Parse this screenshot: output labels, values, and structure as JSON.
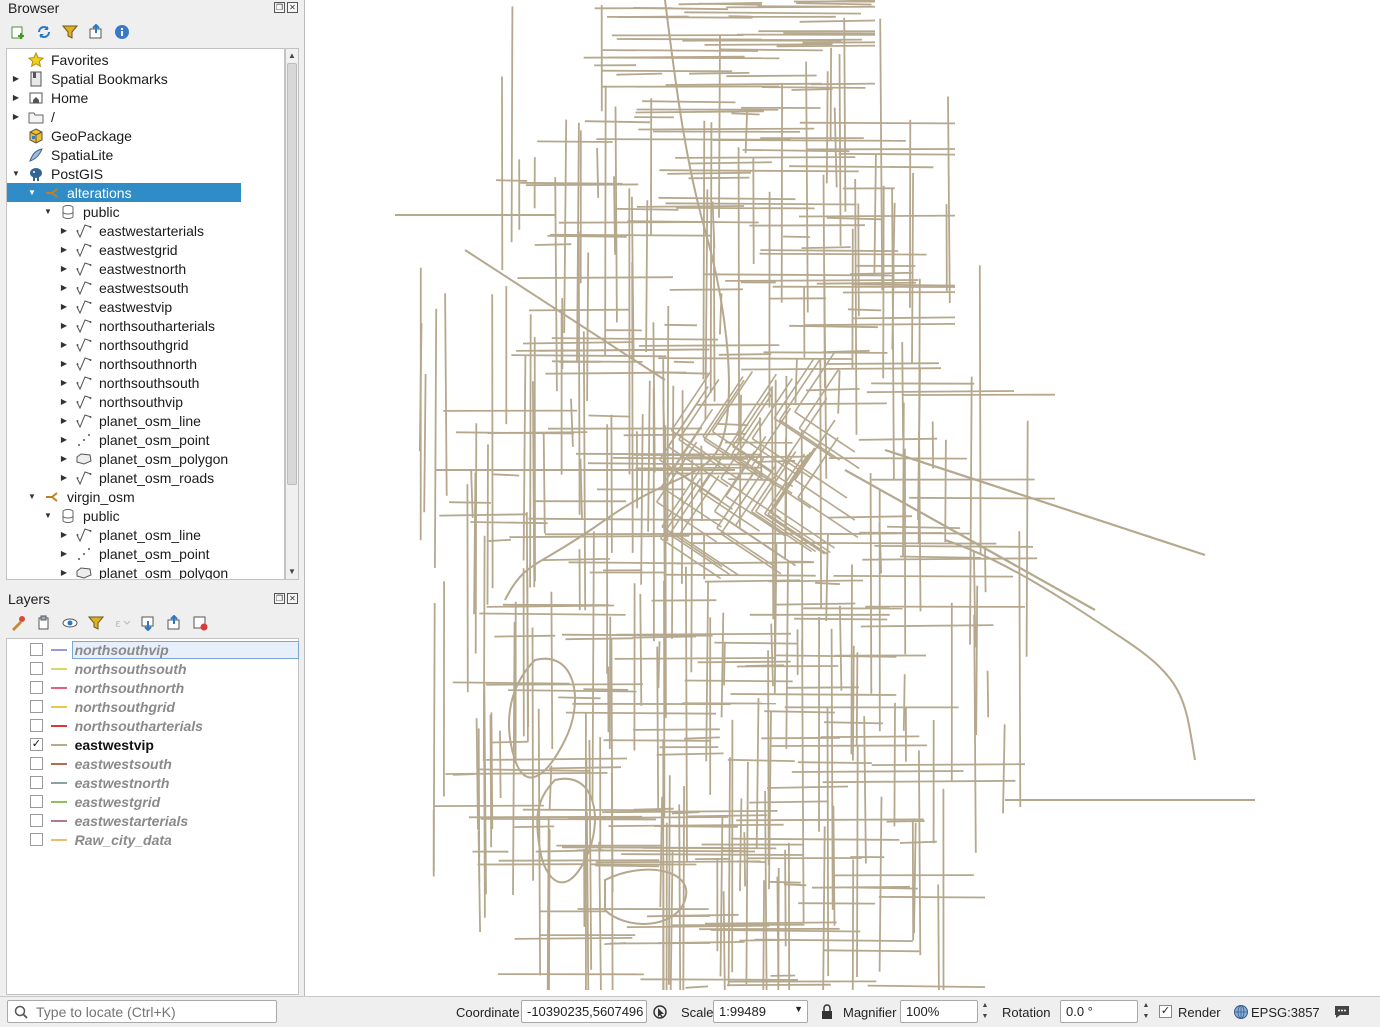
{
  "browser": {
    "title": "Browser",
    "toolbar": [
      "add-layer-icon",
      "refresh-icon",
      "filter-icon",
      "collapse-all-icon",
      "info-icon"
    ],
    "items": [
      {
        "label": "Favorites",
        "icon": "star-icon",
        "depth": 0,
        "arrow": ""
      },
      {
        "label": "Spatial Bookmarks",
        "icon": "bookmark-icon",
        "depth": 0,
        "arrow": "▶"
      },
      {
        "label": "Home",
        "icon": "home-icon",
        "depth": 0,
        "arrow": "▶"
      },
      {
        "label": "/",
        "icon": "folder-icon",
        "depth": 0,
        "arrow": "▶"
      },
      {
        "label": "GeoPackage",
        "icon": "geopackage-icon",
        "depth": 0,
        "arrow": ""
      },
      {
        "label": "SpatiaLite",
        "icon": "spatialite-icon",
        "depth": 0,
        "arrow": ""
      },
      {
        "label": "PostGIS",
        "icon": "postgis-elephant-icon",
        "depth": 0,
        "arrow": "▼"
      },
      {
        "label": "alterations",
        "icon": "connection-icon",
        "depth": 1,
        "arrow": "▼",
        "selected": true
      },
      {
        "label": "public",
        "icon": "schema-icon",
        "depth": 2,
        "arrow": "▼"
      },
      {
        "label": "eastwestarterials",
        "icon": "line-layer-icon",
        "depth": 3,
        "arrow": "▶"
      },
      {
        "label": "eastwestgrid",
        "icon": "line-layer-icon",
        "depth": 3,
        "arrow": "▶"
      },
      {
        "label": "eastwestnorth",
        "icon": "line-layer-icon",
        "depth": 3,
        "arrow": "▶"
      },
      {
        "label": "eastwestsouth",
        "icon": "line-layer-icon",
        "depth": 3,
        "arrow": "▶"
      },
      {
        "label": "eastwestvip",
        "icon": "line-layer-icon",
        "depth": 3,
        "arrow": "▶"
      },
      {
        "label": "northsoutharterials",
        "icon": "line-layer-icon",
        "depth": 3,
        "arrow": "▶"
      },
      {
        "label": "northsouthgrid",
        "icon": "line-layer-icon",
        "depth": 3,
        "arrow": "▶"
      },
      {
        "label": "northsouthnorth",
        "icon": "line-layer-icon",
        "depth": 3,
        "arrow": "▶"
      },
      {
        "label": "northsouthsouth",
        "icon": "line-layer-icon",
        "depth": 3,
        "arrow": "▶"
      },
      {
        "label": "northsouthvip",
        "icon": "line-layer-icon",
        "depth": 3,
        "arrow": "▶"
      },
      {
        "label": "planet_osm_line",
        "icon": "line-layer-icon",
        "depth": 3,
        "arrow": "▶"
      },
      {
        "label": "planet_osm_point",
        "icon": "point-layer-icon",
        "depth": 3,
        "arrow": "▶"
      },
      {
        "label": "planet_osm_polygon",
        "icon": "polygon-layer-icon",
        "depth": 3,
        "arrow": "▶"
      },
      {
        "label": "planet_osm_roads",
        "icon": "line-layer-icon",
        "depth": 3,
        "arrow": "▶"
      },
      {
        "label": "virgin_osm",
        "icon": "connection-icon",
        "depth": 1,
        "arrow": "▼"
      },
      {
        "label": "public",
        "icon": "schema-icon",
        "depth": 2,
        "arrow": "▼"
      },
      {
        "label": "planet_osm_line",
        "icon": "line-layer-icon",
        "depth": 3,
        "arrow": "▶"
      },
      {
        "label": "planet_osm_point",
        "icon": "point-layer-icon",
        "depth": 3,
        "arrow": "▶"
      },
      {
        "label": "planet_osm_polygon",
        "icon": "polygon-layer-icon",
        "depth": 3,
        "arrow": "▶"
      }
    ]
  },
  "layers": {
    "title": "Layers",
    "toolbar": [
      "style-icon",
      "add-group-icon",
      "visibility-icon",
      "filter-legend-icon",
      "filter-expression-icon",
      "expand-all-icon",
      "collapse-all-icon",
      "remove-layer-icon"
    ],
    "items": [
      {
        "name": "northsouthvip",
        "checked": false,
        "color": "#9a9ad8",
        "current": true
      },
      {
        "name": "northsouthsouth",
        "checked": false,
        "color": "#d8d76a"
      },
      {
        "name": "northsouthnorth",
        "checked": false,
        "color": "#e0607a"
      },
      {
        "name": "northsouthgrid",
        "checked": false,
        "color": "#e8c850"
      },
      {
        "name": "northsoutharterials",
        "checked": false,
        "color": "#d83a3a"
      },
      {
        "name": "eastwestvip",
        "checked": true,
        "color": "#b8aa8c"
      },
      {
        "name": "eastwestsouth",
        "checked": false,
        "color": "#b86a4a"
      },
      {
        "name": "eastwestnorth",
        "checked": false,
        "color": "#8aa0a8"
      },
      {
        "name": "eastwestgrid",
        "checked": false,
        "color": "#8cc060"
      },
      {
        "name": "eastwestarterials",
        "checked": false,
        "color": "#b07a8a"
      },
      {
        "name": "Raw_city_data",
        "checked": false,
        "color": "#e8c070"
      }
    ]
  },
  "map": {
    "line_color": "#b5a88d"
  },
  "status": {
    "locate_placeholder": "Type to locate (Ctrl+K)",
    "coordinate_label": "Coordinate",
    "coordinate_value": "-10390235,5607496",
    "scale_label": "Scale",
    "scale_value": "1:99489",
    "magnifier_label": "Magnifier",
    "magnifier_value": "100%",
    "rotation_label": "Rotation",
    "rotation_value": "0.0 °",
    "render_label": "Render",
    "render_checked": true,
    "crs": "EPSG:3857"
  }
}
